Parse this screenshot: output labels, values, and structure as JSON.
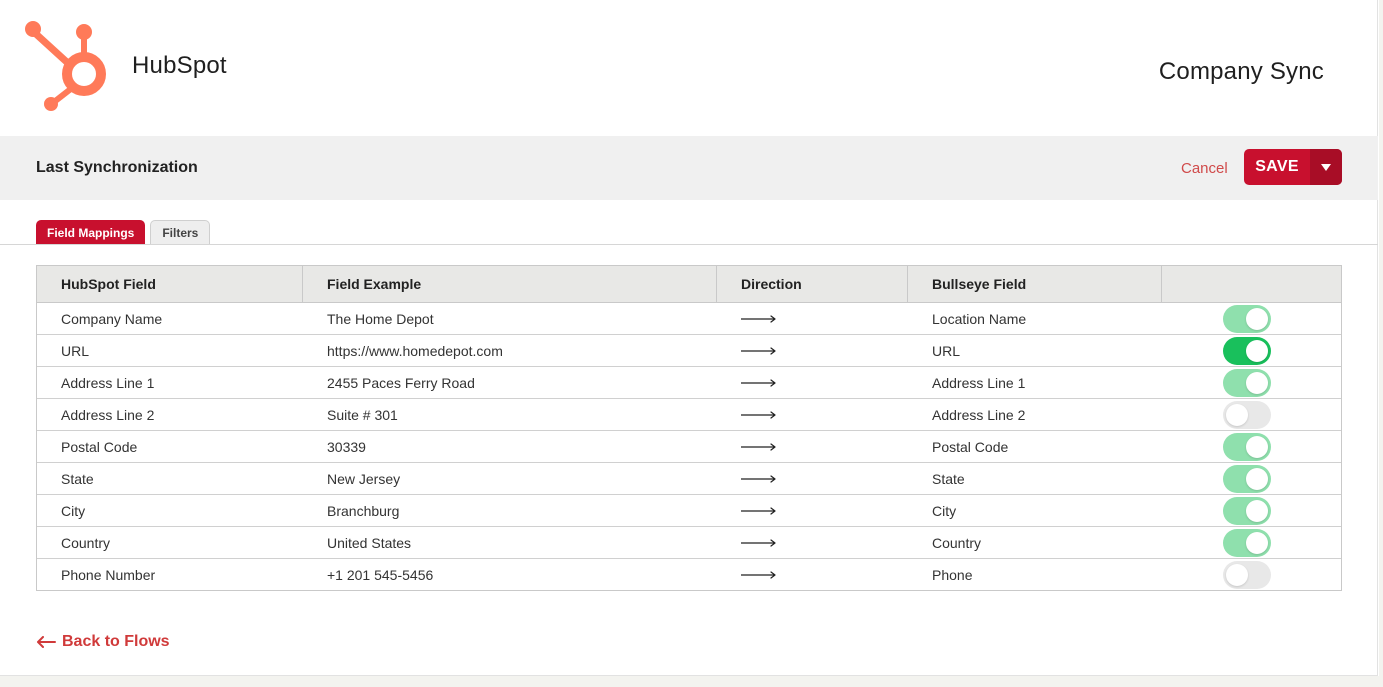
{
  "header": {
    "brand_name": "HubSpot",
    "page_title": "Company Sync",
    "logo_icon": "hubspot-sprocket-icon",
    "brand_color": "#ff7a59"
  },
  "sync_bar": {
    "title": "Last Synchronization",
    "cancel_label": "Cancel",
    "save_label": "SAVE",
    "save_dropdown_icon": "caret-down-icon",
    "accent_color": "#c8102e"
  },
  "tabs": [
    {
      "label": "Field Mappings",
      "active": true
    },
    {
      "label": "Filters",
      "active": false
    }
  ],
  "table": {
    "columns": [
      "HubSpot Field",
      "Field Example",
      "Direction",
      "Bullseye Field",
      ""
    ],
    "rows": [
      {
        "hubspot_field": "Company Name",
        "example": "The Home Depot",
        "direction": "right-arrow-icon",
        "bullseye_field": "Location Name",
        "enabled": true,
        "style": "muted"
      },
      {
        "hubspot_field": "URL",
        "example": "https://www.homedepot.com",
        "direction": "right-arrow-icon",
        "bullseye_field": "URL",
        "enabled": true,
        "style": "strong"
      },
      {
        "hubspot_field": "Address Line 1",
        "example": "2455 Paces Ferry Road",
        "direction": "right-arrow-icon",
        "bullseye_field": "Address Line 1",
        "enabled": true,
        "style": "muted"
      },
      {
        "hubspot_field": "Address Line 2",
        "example": "Suite # 301",
        "direction": "right-arrow-icon",
        "bullseye_field": "Address Line 2",
        "enabled": false,
        "style": "off"
      },
      {
        "hubspot_field": "Postal Code",
        "example": "30339",
        "direction": "right-arrow-icon",
        "bullseye_field": "Postal Code",
        "enabled": true,
        "style": "muted"
      },
      {
        "hubspot_field": "State",
        "example": "New Jersey",
        "direction": "right-arrow-icon",
        "bullseye_field": "State",
        "enabled": true,
        "style": "muted"
      },
      {
        "hubspot_field": "City",
        "example": "Branchburg",
        "direction": "right-arrow-icon",
        "bullseye_field": "City",
        "enabled": true,
        "style": "muted"
      },
      {
        "hubspot_field": "Country",
        "example": "United States",
        "direction": "right-arrow-icon",
        "bullseye_field": "Country",
        "enabled": true,
        "style": "muted"
      },
      {
        "hubspot_field": "Phone Number",
        "example": "+1 201 545-5456",
        "direction": "right-arrow-icon",
        "bullseye_field": "Phone",
        "enabled": false,
        "style": "off"
      }
    ],
    "toggle_on_color": "#8fe0ad",
    "toggle_active_color": "#19c05c",
    "toggle_off_color": "#e8e8e8"
  },
  "footer": {
    "back_label": "Back to Flows",
    "back_icon": "left-arrow-icon"
  }
}
